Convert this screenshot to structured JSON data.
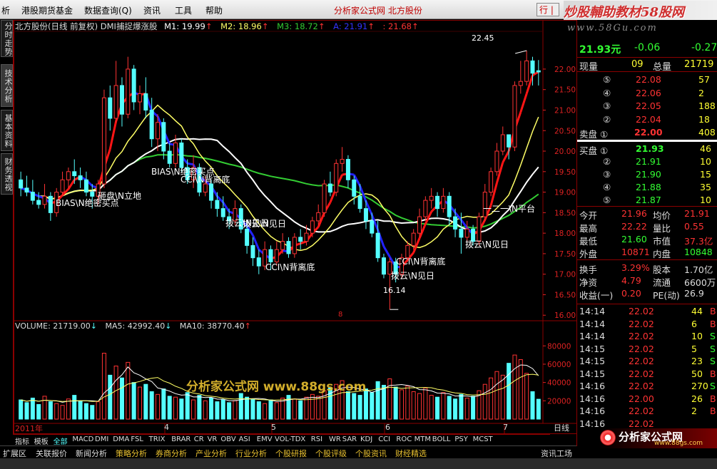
{
  "menu": {
    "items": [
      "析",
      "港股期货基金",
      "数据查询(Q)",
      "资讯",
      "工具",
      "帮助"
    ],
    "app_title": "分析家公式网 北方股份",
    "right_button": "行 |"
  },
  "brand": {
    "title": "炒股輔助教材58股网",
    "url": "www.58Gu.com"
  },
  "left_tabs": [
    "分时走势",
    "技术分析",
    "基本资料",
    "财务透视"
  ],
  "chart_header": {
    "title": "北方股份(日线 前复权) DMI捕捉爆涨股",
    "m1_label": "M1: 19.99",
    "m1_arrow": "↑",
    "m2_label": "M2: 18.96",
    "m2_arrow": "↑",
    "m3_label": "M3: 18.72",
    "m3_arrow": "↑",
    "a_label": "A: 21.91",
    "a_arrow": "↑",
    "b_label": ": 21.68",
    "b_arrow": "↑"
  },
  "volume_header": {
    "vol_label": "VOLUME: 21719.00",
    "vol_arrow": "↓",
    "ma5_label": "MA5: 42992.40",
    "ma5_arrow": "↓",
    "ma10_label": "MA10: 38770.40",
    "ma10_arrow": "↑"
  },
  "annotations": {
    "a1": "BIAS\\N绝密买点",
    "a2": "砸盘\\N立地",
    "a3": "BIAS\\N绝密买点",
    "a4": "CCI\\N背离底",
    "a5": "拨云\\N见日",
    "a6": "拨云\\N见日",
    "a7": "CCI\\N背离底",
    "a8": "CCI\\N背离底",
    "a9": "拨云\\N见日",
    "a10": "拨云\\N见日",
    "a11": "一二一\\N平台",
    "hi": "22.45",
    "lo": "16.14",
    "watermark": "分析家公式网 www.88gs.com"
  },
  "x_axis": {
    "year": "2011年",
    "m4": "4",
    "m5": "5",
    "m6": "6",
    "m7": "7",
    "period": "日线",
    "mid_mark": "8"
  },
  "indicator_tabs": [
    "指标",
    "模板",
    "全部",
    "MACD",
    "DMI",
    "DMA",
    "FSL",
    "TRIX",
    "BRAR",
    "CR",
    "VR",
    "OBV",
    "ASI",
    "EMV",
    "VOL-TDX",
    "RSI",
    "WR",
    "SAR",
    "KDJ",
    "CCI",
    "ROC",
    "MTM",
    "BOLL",
    "PSY",
    "MCST"
  ],
  "bottom_tabs": [
    "扩展区",
    "关联报价",
    "新闻分析",
    "策略分析",
    "券商分析",
    "产业分析",
    "行业分析",
    "个股研报",
    "个股评级",
    "个股资讯",
    "财经精选",
    "资讯工场"
  ],
  "quote": {
    "price": "21.93元",
    "change": "-0.06",
    "pct": "-0.27",
    "vol_label": "现量",
    "vol_val": "09",
    "total_label": "总量",
    "total_val": "21719",
    "sells": [
      {
        "n": "⑤",
        "p": "22.08",
        "v": "57"
      },
      {
        "n": "④",
        "p": "22.06",
        "v": "2"
      },
      {
        "n": "③",
        "p": "22.05",
        "v": "188"
      },
      {
        "n": "②",
        "p": "22.04",
        "v": "18"
      },
      {
        "n": "卖盘 ①",
        "p": "22.00",
        "v": "408"
      }
    ],
    "buys": [
      {
        "n": "买盘 ①",
        "p": "21.93",
        "v": "46"
      },
      {
        "n": "②",
        "p": "21.91",
        "v": "10"
      },
      {
        "n": "③",
        "p": "21.90",
        "v": "15"
      },
      {
        "n": "④",
        "p": "21.88",
        "v": "35"
      },
      {
        "n": "⑤",
        "p": "21.87",
        "v": "10"
      }
    ],
    "stats": [
      [
        "今开",
        "21.96",
        "均价",
        "21.91"
      ],
      [
        "最高",
        "22.22",
        "量比",
        "0.55"
      ],
      [
        "最低",
        "21.60",
        "市值",
        "37.3亿"
      ],
      [
        "外盘",
        "10871",
        "内盘",
        "10848"
      ],
      [
        "换手",
        "3.29%",
        "股本",
        "1.70亿"
      ],
      [
        "净资",
        "4.79",
        "流通",
        "6600万"
      ],
      [
        "收益(一)",
        "0.20",
        "PE(动)",
        "26.9"
      ]
    ],
    "ticks": [
      [
        "14:14",
        "22.02",
        "44",
        "B"
      ],
      [
        "14:14",
        "22.02",
        "6",
        "B"
      ],
      [
        "14:14",
        "22.02",
        "10",
        "S"
      ],
      [
        "14:15",
        "22.02",
        "5",
        "S"
      ],
      [
        "14:15",
        "22.02",
        "23",
        "S"
      ],
      [
        "14:15",
        "22.02",
        "50",
        "B"
      ],
      [
        "14:16",
        "22.02",
        "270",
        "S"
      ],
      [
        "14:16",
        "22.00",
        "26",
        "B"
      ],
      [
        "14:16",
        "22.02",
        "2",
        "B"
      ],
      [
        "14:16",
        "22.02",
        "",
        ""
      ]
    ]
  },
  "price_axis": [
    "22.00",
    "21.50",
    "21.00",
    "20.50",
    "20.00",
    "19.50",
    "19.00",
    "18.50",
    "18.00",
    "17.50",
    "17.00",
    "16.50",
    "16.00"
  ],
  "volume_axis": [
    "80000",
    "60000",
    "40000",
    "20000"
  ],
  "logo": {
    "text": "分析家公式网",
    "url": "www.88gs.com"
  },
  "colors": {
    "up": "#ff3333",
    "down": "#54ffff",
    "white": "#ffffff",
    "yellow": "#ffff66",
    "green": "#33cc33",
    "blue": "#2222ff",
    "red": "#ff1515"
  },
  "chart_data": {
    "type": "candlestick",
    "title": "北方股份(日线 前复权) DMI捕捉爆涨股",
    "ylim": [
      15.9,
      22.85
    ],
    "volume_ylim": [
      0,
      95000
    ],
    "candles": [
      [
        19.3,
        19.5,
        19.1,
        18.9
      ],
      [
        19.1,
        19.4,
        19.0,
        18.9
      ],
      [
        19.0,
        19.3,
        18.8,
        18.7
      ],
      [
        18.8,
        19.0,
        18.7,
        18.6
      ],
      [
        18.7,
        19.2,
        18.9,
        18.6
      ],
      [
        18.9,
        19.0,
        18.5,
        18.3
      ],
      [
        18.5,
        19.1,
        19.0,
        18.4
      ],
      [
        19.0,
        19.5,
        19.3,
        18.9
      ],
      [
        19.3,
        19.6,
        19.5,
        19.1
      ],
      [
        19.5,
        19.8,
        19.4,
        19.2
      ],
      [
        19.4,
        19.6,
        19.3,
        19.1
      ],
      [
        19.3,
        19.5,
        19.0,
        18.9
      ],
      [
        19.0,
        19.2,
        18.9,
        18.6
      ],
      [
        18.9,
        19.3,
        19.2,
        18.7
      ],
      [
        19.2,
        21.5,
        21.3,
        19.1
      ],
      [
        21.3,
        21.6,
        20.8,
        20.5
      ],
      [
        20.8,
        22.2,
        21.6,
        20.7
      ],
      [
        21.6,
        21.8,
        20.9,
        20.6
      ],
      [
        20.9,
        22.3,
        22.0,
        20.8
      ],
      [
        22.0,
        22.1,
        21.2,
        21.0
      ],
      [
        21.2,
        21.6,
        21.4,
        20.9
      ],
      [
        21.4,
        21.8,
        21.0,
        20.8
      ],
      [
        21.0,
        21.3,
        20.3,
        20.1
      ],
      [
        20.3,
        20.9,
        20.7,
        20.0
      ],
      [
        20.7,
        20.8,
        20.0,
        19.8
      ],
      [
        20.0,
        20.2,
        19.7,
        19.6
      ],
      [
        19.7,
        20.4,
        20.2,
        19.6
      ],
      [
        20.2,
        20.3,
        19.6,
        19.5
      ],
      [
        19.6,
        19.8,
        19.3,
        19.2
      ],
      [
        19.3,
        19.9,
        19.6,
        19.1
      ],
      [
        19.6,
        19.7,
        19.0,
        18.9
      ],
      [
        19.0,
        19.4,
        19.2,
        18.9
      ],
      [
        19.2,
        19.3,
        18.8,
        18.6
      ],
      [
        18.8,
        19.0,
        18.6,
        18.4
      ],
      [
        18.6,
        18.9,
        18.4,
        18.3
      ],
      [
        18.4,
        18.6,
        18.3,
        18.1
      ],
      [
        18.3,
        18.8,
        18.6,
        18.2
      ],
      [
        18.6,
        18.7,
        18.1,
        18.0
      ],
      [
        18.1,
        18.3,
        17.7,
        17.5
      ],
      [
        17.7,
        17.9,
        17.4,
        17.2
      ],
      [
        17.4,
        17.6,
        17.2,
        17.0
      ],
      [
        17.2,
        17.8,
        17.6,
        17.1
      ],
      [
        17.6,
        17.7,
        17.3,
        17.1
      ],
      [
        17.3,
        17.8,
        17.6,
        17.2
      ],
      [
        17.6,
        18.0,
        17.8,
        17.5
      ],
      [
        17.8,
        17.9,
        17.5,
        17.4
      ],
      [
        17.5,
        18.0,
        17.9,
        17.4
      ],
      [
        17.9,
        18.1,
        17.8,
        17.6
      ],
      [
        17.8,
        18.2,
        18.0,
        17.7
      ],
      [
        18.0,
        18.4,
        18.3,
        17.9
      ],
      [
        18.3,
        18.7,
        18.5,
        18.2
      ],
      [
        18.5,
        19.3,
        19.2,
        18.4
      ],
      [
        19.2,
        19.5,
        19.0,
        18.9
      ],
      [
        19.0,
        19.8,
        19.7,
        18.9
      ],
      [
        19.7,
        20.1,
        19.8,
        19.5
      ],
      [
        19.8,
        19.9,
        19.3,
        19.1
      ],
      [
        19.3,
        19.4,
        18.9,
        18.7
      ],
      [
        18.9,
        19.2,
        18.6,
        18.5
      ],
      [
        18.6,
        18.8,
        18.3,
        18.1
      ],
      [
        18.3,
        18.5,
        18.0,
        17.9
      ],
      [
        18.0,
        18.3,
        17.4,
        17.3
      ],
      [
        17.4,
        17.5,
        17.0,
        16.9
      ],
      [
        17.0,
        17.4,
        17.3,
        16.14
      ],
      [
        17.3,
        17.4,
        17.0,
        16.8
      ],
      [
        17.0,
        17.5,
        17.4,
        16.9
      ],
      [
        17.4,
        17.8,
        17.7,
        17.3
      ],
      [
        17.7,
        18.1,
        18.0,
        17.6
      ],
      [
        18.0,
        18.6,
        18.4,
        17.9
      ],
      [
        18.4,
        18.9,
        18.8,
        18.3
      ],
      [
        18.8,
        19.1,
        18.9,
        18.6
      ],
      [
        18.9,
        19.0,
        18.6,
        18.4
      ],
      [
        18.6,
        19.1,
        18.9,
        18.5
      ],
      [
        18.9,
        19.0,
        18.4,
        18.2
      ],
      [
        18.4,
        18.6,
        18.1,
        17.9
      ],
      [
        18.1,
        18.5,
        17.9,
        17.5
      ],
      [
        17.9,
        18.3,
        18.1,
        17.8
      ],
      [
        18.1,
        18.2,
        17.8,
        17.7
      ],
      [
        17.8,
        18.5,
        18.4,
        17.7
      ],
      [
        18.4,
        19.2,
        19.0,
        18.3
      ],
      [
        19.0,
        19.6,
        19.5,
        18.9
      ],
      [
        19.5,
        20.2,
        20.0,
        19.4
      ],
      [
        20.0,
        20.6,
        20.4,
        19.9
      ],
      [
        20.4,
        20.4,
        20.1,
        19.8
      ],
      [
        20.1,
        21.7,
        21.6,
        20.0
      ],
      [
        21.6,
        22.2,
        21.7,
        21.4
      ],
      [
        21.7,
        22.45,
        22.2,
        21.6
      ],
      [
        22.2,
        22.3,
        21.9,
        21.6
      ],
      [
        21.96,
        22.22,
        21.93,
        21.6
      ]
    ],
    "volumes": [
      21000,
      18000,
      23000,
      16000,
      25000,
      19000,
      17000,
      15000,
      22000,
      26000,
      20000,
      17000,
      15000,
      19000,
      72000,
      48000,
      58000,
      45000,
      62000,
      40000,
      35000,
      38000,
      30000,
      27000,
      33000,
      25000,
      24000,
      22000,
      29000,
      21000,
      26000,
      20000,
      23000,
      19000,
      21000,
      18000,
      20000,
      28000,
      24000,
      22000,
      19000,
      17000,
      21000,
      18000,
      23000,
      26000,
      22000,
      20000,
      24000,
      27000,
      25000,
      31000,
      34000,
      38000,
      42000,
      30000,
      28000,
      26000,
      33000,
      29000,
      41000,
      37000,
      44000,
      35000,
      32000,
      36000,
      30000,
      28000,
      34000,
      26000,
      24000,
      29000,
      25000,
      22000,
      27000,
      23000,
      25000,
      31000,
      38000,
      45000,
      52000,
      48000,
      61000,
      70000,
      65000,
      50000,
      30000,
      21719
    ]
  }
}
